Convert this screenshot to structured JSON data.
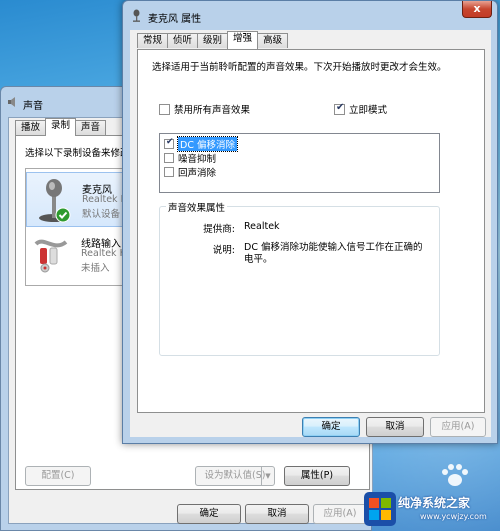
{
  "background_window": {
    "title": "声音",
    "tabs": [
      "播放",
      "录制",
      "声音"
    ],
    "active_tab": 1,
    "instruction": "选择以下录制设备来修改",
    "devices": [
      {
        "name": "麦克风",
        "sub": "Realtek Hi",
        "status": "默认设备",
        "selected": true,
        "icon": "microphone-icon"
      },
      {
        "name": "线路输入",
        "sub": "Realtek Hi",
        "status": "未插入",
        "selected": false,
        "icon": "line-in-icon"
      }
    ],
    "buttons": {
      "configure": "配置(C)",
      "set_default": "设为默认值(S)",
      "properties": "属性(P)",
      "ok": "确定",
      "cancel": "取消",
      "apply": "应用(A)"
    }
  },
  "properties_window": {
    "title": "麦克风 属性",
    "close_label": "x",
    "tabs": [
      "常规",
      "侦听",
      "级别",
      "增强",
      "高级"
    ],
    "active_tab": 3,
    "description": "选择适用于当前聆听配置的声音效果。下次开始播放时更改才会生效。",
    "disable_all_label": "禁用所有声音效果",
    "disable_all_checked": false,
    "immediate_mode_label": "立即模式",
    "immediate_mode_checked": true,
    "effects": [
      {
        "label": "DC 偏移消除",
        "checked": true,
        "selected": true
      },
      {
        "label": "噪音抑制",
        "checked": false,
        "selected": false
      },
      {
        "label": "回声消除",
        "checked": false,
        "selected": false
      }
    ],
    "effect_props": {
      "group_label": "声音效果属性",
      "provider_key": "提供商:",
      "provider_val": "Realtek",
      "desc_key": "说明:",
      "desc_val": "DC 偏移消除功能使输入信号工作在正确的电平。"
    },
    "buttons": {
      "ok": "确定",
      "cancel": "取消",
      "apply": "应用(A)"
    }
  },
  "watermark": {
    "title": "纯净系统之家",
    "url": "www.ycwjzy.com"
  }
}
